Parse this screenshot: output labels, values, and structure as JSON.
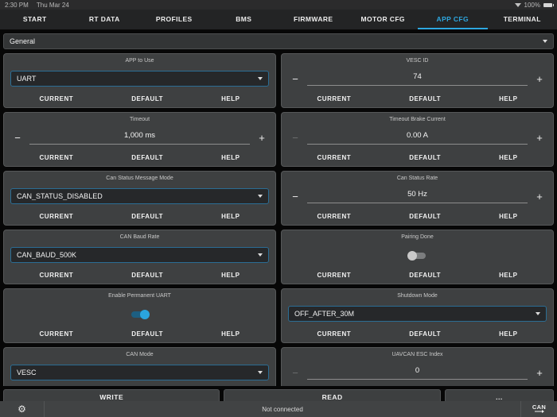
{
  "status_bar": {
    "time": "2:30 PM",
    "date": "Thu Mar 24",
    "battery_percent": "100%"
  },
  "tabs": [
    {
      "label": "START",
      "active": false
    },
    {
      "label": "RT DATA",
      "active": false
    },
    {
      "label": "PROFILES",
      "active": false
    },
    {
      "label": "BMS",
      "active": false
    },
    {
      "label": "FIRMWARE",
      "active": false
    },
    {
      "label": "MOTOR CFG",
      "active": false
    },
    {
      "label": "APP CFG",
      "active": true
    },
    {
      "label": "TERMINAL",
      "active": false
    }
  ],
  "group_selector": {
    "value": "General"
  },
  "card_actions": {
    "current": "CURRENT",
    "default": "DEFAULT",
    "help": "HELP"
  },
  "cards": [
    {
      "title": "APP to Use",
      "type": "combo",
      "value": "UART"
    },
    {
      "title": "VESC ID",
      "type": "stepper",
      "value": "74",
      "minus_enabled": true
    },
    {
      "title": "Timeout",
      "type": "stepper",
      "value": "1,000 ms",
      "minus_enabled": true
    },
    {
      "title": "Timeout Brake Current",
      "type": "stepper",
      "value": "0.00 A",
      "minus_enabled": false
    },
    {
      "title": "Can Status Message Mode",
      "type": "combo",
      "value": "CAN_STATUS_DISABLED"
    },
    {
      "title": "Can Status Rate",
      "type": "stepper",
      "value": "50 Hz",
      "minus_enabled": true
    },
    {
      "title": "CAN Baud Rate",
      "type": "combo",
      "value": "CAN_BAUD_500K"
    },
    {
      "title": "Pairing Done",
      "type": "toggle",
      "on": false
    },
    {
      "title": "Enable Permanent UART",
      "type": "toggle",
      "on": true
    },
    {
      "title": "Shutdown Mode",
      "type": "combo",
      "value": "OFF_AFTER_30M"
    },
    {
      "title": "CAN Mode",
      "type": "combo",
      "value": "VESC"
    },
    {
      "title": "UAVCAN ESC Index",
      "type": "stepper",
      "value": "0",
      "minus_enabled": false
    }
  ],
  "footer_buttons": {
    "write": "WRITE",
    "read": "READ",
    "more": "..."
  },
  "bottom_bar": {
    "status": "Not connected",
    "can_label": "CAN"
  },
  "colors": {
    "accent": "#2ea7e0",
    "combo_border": "#2b6d94",
    "card_bg": "#3e4041",
    "toggle_on": "#2aa4dd"
  }
}
